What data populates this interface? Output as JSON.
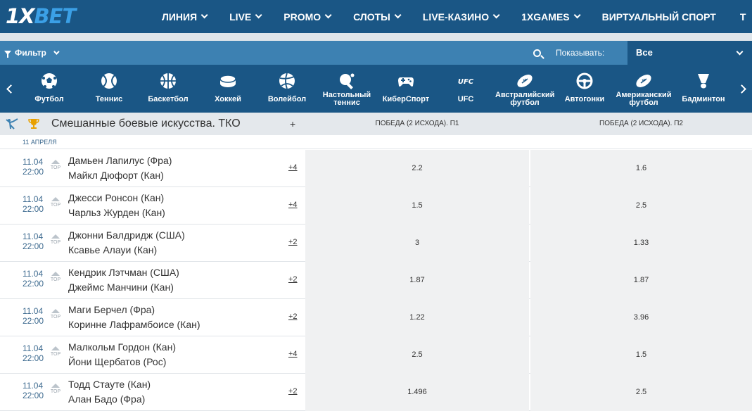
{
  "brand": {
    "logo_prefix": "1X",
    "logo_suffix": "BET"
  },
  "nav": [
    "ЛИНИЯ",
    "LIVE",
    "PROMO",
    "СЛОТЫ",
    "LIVE-КАЗИНО",
    "1XGAMES",
    "ВИРТУАЛЬНЫЙ СПОРТ",
    "Т"
  ],
  "filter": {
    "label": "Фильтр",
    "show_label": "Показывать:",
    "show_value": "Все"
  },
  "sports": [
    {
      "line1": "Футбол",
      "line2": ""
    },
    {
      "line1": "Теннис",
      "line2": ""
    },
    {
      "line1": "Баскетбол",
      "line2": ""
    },
    {
      "line1": "Хоккей",
      "line2": ""
    },
    {
      "line1": "Волейбол",
      "line2": ""
    },
    {
      "line1": "Настольный",
      "line2": "теннис"
    },
    {
      "line1": "КиберСпорт",
      "line2": ""
    },
    {
      "line1": "UFC",
      "line2": ""
    },
    {
      "line1": "Австралийский",
      "line2": "футбол"
    },
    {
      "line1": "Автогонки",
      "line2": ""
    },
    {
      "line1": "Американский",
      "line2": "футбол"
    },
    {
      "line1": "Бадминтон",
      "line2": ""
    }
  ],
  "league": {
    "title": "Смешанные боевые искусства. ТКО",
    "plus": "+",
    "col1": "ПОБЕДА (2 ИСХОДА). П1",
    "col2": "ПОБЕДА (2 ИСХОДА). П2"
  },
  "date_header": "11 АПРЕЛЯ",
  "matches": [
    {
      "date": "11.04",
      "time": "22:00",
      "top": "TOP",
      "team1": "Дамьен Лапилус (Фра)",
      "team2": "Майкл Дюфорт (Кан)",
      "more": "+4",
      "p1": "2.2",
      "p2": "1.6"
    },
    {
      "date": "11.04",
      "time": "22:00",
      "top": "TOP",
      "team1": "Джесси Ронсон (Кан)",
      "team2": "Чарльз Журден (Кан)",
      "more": "+4",
      "p1": "1.5",
      "p2": "2.5"
    },
    {
      "date": "11.04",
      "time": "22:00",
      "top": "TOP",
      "team1": "Джонни Балдридж (США)",
      "team2": "Ксавье Алауи (Кан)",
      "more": "+2",
      "p1": "3",
      "p2": "1.33"
    },
    {
      "date": "11.04",
      "time": "22:00",
      "top": "TOP",
      "team1": "Кендрик Лэтчман (США)",
      "team2": "Джеймс Манчини (Кан)",
      "more": "+2",
      "p1": "1.87",
      "p2": "1.87"
    },
    {
      "date": "11.04",
      "time": "22:00",
      "top": "TOP",
      "team1": "Маги Берчел (Фра)",
      "team2": "Коринне Лафрамбоисе (Кан)",
      "more": "+2",
      "p1": "1.22",
      "p2": "3.96"
    },
    {
      "date": "11.04",
      "time": "22:00",
      "top": "TOP",
      "team1": "Малкольм Гордон (Кан)",
      "team2": "Йони Щербатов (Рос)",
      "more": "+4",
      "p1": "2.5",
      "p2": "1.5"
    },
    {
      "date": "11.04",
      "time": "22:00",
      "top": "TOP",
      "team1": "Тодд Стауте (Кан)",
      "team2": "Алан Бадо (Фра)",
      "more": "+2",
      "p1": "1.496",
      "p2": "2.5"
    }
  ],
  "colors": {
    "nav_bg": "#1a5685",
    "filter_bg": "#3d81b2",
    "logo_accent": "#3ba0e6",
    "odd_bg": "#f0f1f2"
  }
}
